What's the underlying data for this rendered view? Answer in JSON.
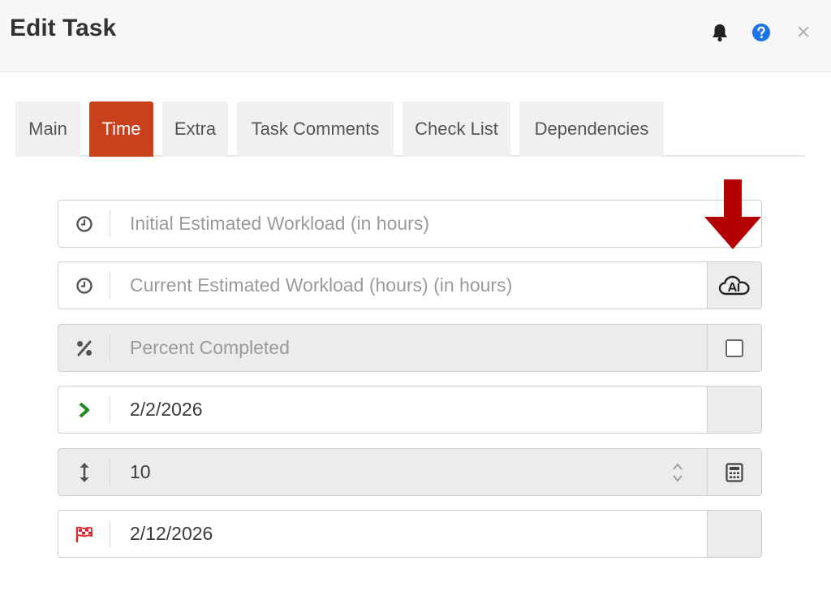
{
  "header": {
    "title": "Edit Task",
    "close_glyph": "×",
    "icons": {
      "bell": "bell-icon",
      "help": "help-circle-icon",
      "close": "close-icon"
    },
    "help_color": "#1a73e8"
  },
  "tabs": [
    {
      "label": "Main",
      "active": false
    },
    {
      "label": "Time",
      "active": true
    },
    {
      "label": "Extra",
      "active": false
    },
    {
      "label": "Task Comments",
      "active": false
    },
    {
      "label": "Check List",
      "active": false
    },
    {
      "label": "Dependencies",
      "active": false
    }
  ],
  "accent_color": "#c9411c",
  "fields": {
    "initial_workload": {
      "placeholder": "Initial Estimated Workload (in hours)",
      "icon": "clock-icon"
    },
    "current_workload": {
      "placeholder": "Current Estimated Workload (hours) (in hours)",
      "icon": "clock-icon",
      "addon_icon": "ai-cloud-icon"
    },
    "percent_completed": {
      "placeholder": "Percent Completed",
      "icon": "percent-icon",
      "addon": "checkbox",
      "checked": false
    },
    "start_date": {
      "value": "2/2/2026",
      "icon": "chevron-right-icon",
      "icon_color": "#1e8a1e"
    },
    "duration": {
      "value": "10",
      "icon": "vertical-resize-icon",
      "addon_icon": "calculator-icon"
    },
    "end_date": {
      "value": "2/12/2026",
      "icon": "checkered-flag-icon",
      "icon_color": "#d9232a"
    }
  },
  "annotation": {
    "icon": "red-down-arrow-icon",
    "color": "#b40000"
  }
}
